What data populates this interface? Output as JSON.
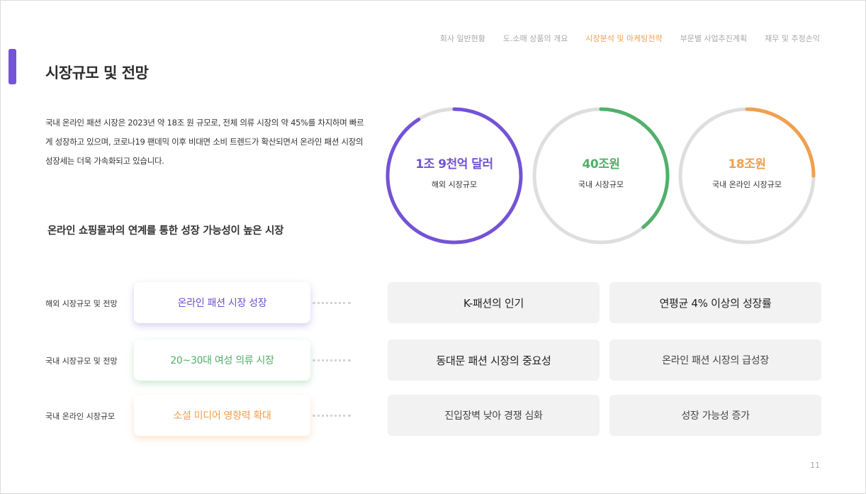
{
  "nav": {
    "items": [
      "회사 일반현황",
      "도.소매 상품의 개요",
      "시장분석 및 마케팅전략",
      "부문별 사업추진계획",
      "재무 및 추정손익"
    ],
    "active_index": 2
  },
  "page": {
    "title": "시장규모 및 전망",
    "intro": "국내 온라인 패션 시장은 2023년 약 18조 원 규모로, 전체 의류 시장의 약 45%를 차지하며 빠르게 성장하고 있으며, 코로나19 팬데믹 이후 비대면 소비 트렌드가 확산되면서 온라인 패션 시장의 성장세는 더욱 가속화되고 있습니다.",
    "subhead": "온라인 쇼핑몰과의 연계를 통한 성장 가능성이 높은 시장",
    "page_number": "11"
  },
  "circles": [
    {
      "value": "1조 9천억 달러",
      "label": "해외 시장규모",
      "fill_percent": 91,
      "color": "#7353d6"
    },
    {
      "value": "40조원",
      "label": "국내 시장규모",
      "fill_percent": 39,
      "color": "#52b06a"
    },
    {
      "value": "18조원",
      "label": "국내 온라인 시장규모",
      "fill_percent": 25,
      "color": "#f0a04e"
    }
  ],
  "rows": [
    {
      "label": "해외 시장규모 및 전망",
      "pill": "온라인 패션 시장 성장",
      "box1": "K-패션의 인기",
      "box2": "연평균 4% 이상의 성장률"
    },
    {
      "label": "국내 시장규모 및 전망",
      "pill": "20~30대 여성 의류 시장",
      "box1": "동대문 패션 시장의 중요성",
      "box2": "온라인 패션 시장의 급성장"
    },
    {
      "label": "국내 온라인 시장규모",
      "pill": "소셜 미디어 영향력 확대",
      "box1": "진입장벽 낮아 경쟁 심화",
      "box2": "성장 가능성  증가"
    }
  ]
}
